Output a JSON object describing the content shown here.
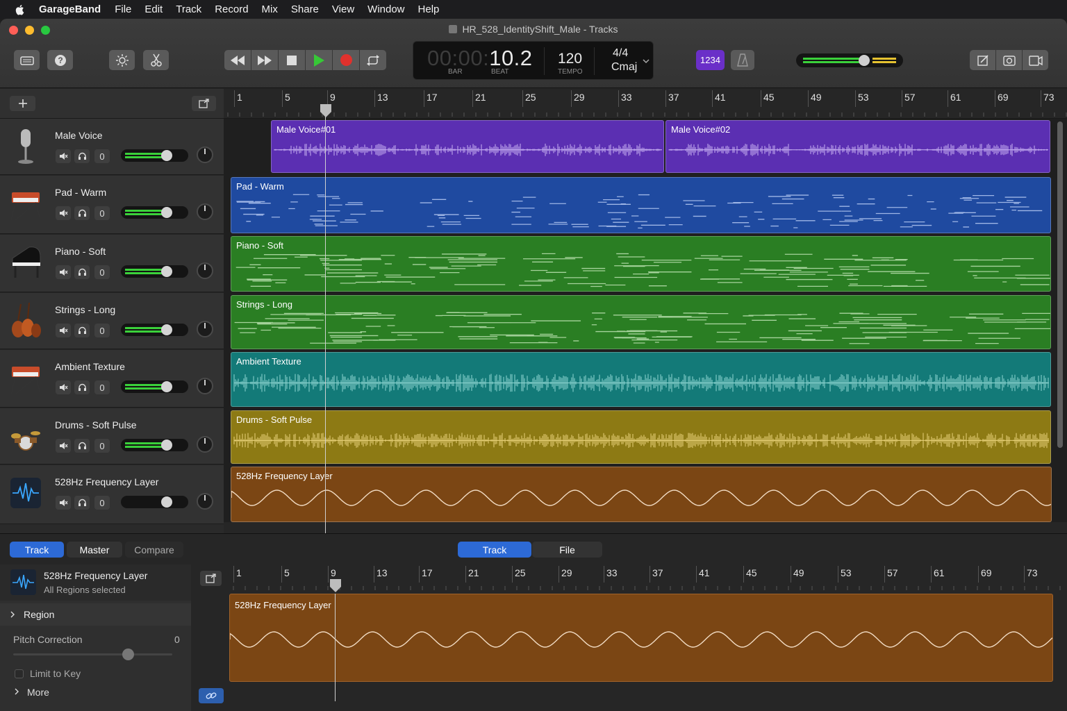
{
  "menubar": {
    "app": "GarageBand",
    "items": [
      "File",
      "Edit",
      "Track",
      "Record",
      "Mix",
      "Share",
      "View",
      "Window",
      "Help"
    ]
  },
  "window": {
    "title": "HR_528_IdentityShift_Male - Tracks"
  },
  "lcd": {
    "position_dim": "00:00:",
    "position_bright": "10.2",
    "bar_label": "BAR",
    "beat_label": "BEAT",
    "tempo": "120",
    "tempo_label": "TEMPO",
    "time_signature": "4/4",
    "key": "Cmaj"
  },
  "count_in": "1234",
  "master_volume_level": 0.65,
  "ruler": {
    "labels": [
      "1",
      "5",
      "9",
      "13",
      "17",
      "21",
      "25",
      "29",
      "33",
      "37",
      "41",
      "45",
      "49",
      "53",
      "57",
      "61",
      "69",
      "73"
    ]
  },
  "tracks": [
    {
      "name": "Male Voice",
      "icon": "microphone-icon",
      "mute_value": "0",
      "volume": 0.72
    },
    {
      "name": "Pad - Warm",
      "icon": "keyboard-icon",
      "mute_value": "0",
      "volume": 0.72
    },
    {
      "name": "Piano - Soft",
      "icon": "grand-piano-icon",
      "mute_value": "0",
      "volume": 0.72
    },
    {
      "name": "Strings - Long",
      "icon": "strings-icon",
      "mute_value": "0",
      "volume": 0.72
    },
    {
      "name": "Ambient Texture",
      "icon": "keyboard-icon",
      "mute_value": "0",
      "volume": 0.72
    },
    {
      "name": "Drums - Soft Pulse",
      "icon": "drum-kit-icon",
      "mute_value": "0",
      "volume": 0.72
    },
    {
      "name": "528Hz Frequency Layer",
      "icon": "waveform-icon",
      "mute_value": "0",
      "volume": 0.72
    }
  ],
  "regions": [
    {
      "name": "Male Voice#01",
      "color": "#5b2fb2"
    },
    {
      "name": "Male Voice#02",
      "color": "#5b2fb2"
    },
    {
      "name": "Pad - Warm",
      "color": "#1f4aa0"
    },
    {
      "name": "Piano - Soft",
      "color": "#2a7e23"
    },
    {
      "name": "Strings - Long",
      "color": "#2a7e23"
    },
    {
      "name": "Ambient Texture",
      "color": "#137a78"
    },
    {
      "name": "Drums - Soft Pulse",
      "color": "#8d7a14"
    },
    {
      "name": "528Hz Frequency Layer",
      "color": "#7b4614"
    }
  ],
  "editor": {
    "left_tabs": [
      "Track",
      "Master",
      "Compare"
    ],
    "right_tabs": [
      "Track",
      "File"
    ],
    "track_name": "528Hz Frequency Layer",
    "track_subtitle": "All Regions selected",
    "region_label": "Region",
    "pitch_correction_label": "Pitch Correction",
    "pitch_correction_value": "0",
    "limit_to_key_label": "Limit to Key",
    "more_label": "More",
    "region_name": "528Hz Frequency Layer",
    "ruler_labels": [
      "1",
      "5",
      "9",
      "13",
      "17",
      "21",
      "25",
      "29",
      "33",
      "37",
      "41",
      "45",
      "49",
      "53",
      "57",
      "61",
      "69",
      "73"
    ]
  },
  "colors": {
    "accent": "#2d6ad6",
    "count_in": "#6a2fc8",
    "play": "#37c837",
    "record": "#e0312d"
  }
}
